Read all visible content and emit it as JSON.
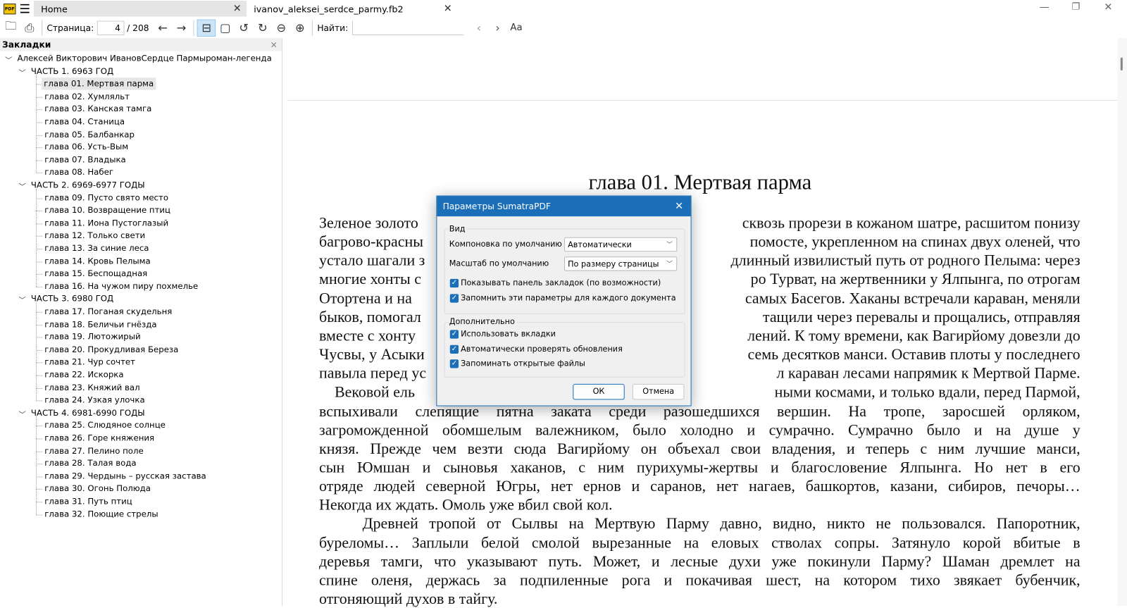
{
  "tabs": [
    {
      "label": "Home",
      "active": false
    },
    {
      "label": "ivanov_aleksei_serdce_parmy.fb2",
      "active": true
    }
  ],
  "toolbar": {
    "page_label": "Страница:",
    "page_current": "4",
    "page_total": "/ 208",
    "find_label": "Найти:",
    "find_value": ""
  },
  "sidebar": {
    "title": "Закладки",
    "root": "Алексей Викторович ИвановСердце Пармыроман-легенда",
    "parts": [
      {
        "label": "ЧАСТЬ 1. 6963 ГОД",
        "chapters": [
          "глава 01. Мертвая парма",
          "глава 02. Хумляльт",
          "глава 03. Канская тамга",
          "глава 04. Станица",
          "глава 05. Балбанкар",
          "глава 06. Усть-Вым",
          "глава 07. Владыка",
          "глава 08. Набег"
        ]
      },
      {
        "label": "ЧАСТЬ 2. 6969-6977 ГОДЫ",
        "chapters": [
          "глава 09. Пусто свято место",
          "глава 10. Возвращение птиц",
          "глава 11. Иона Пустоглазый",
          "глава 12. Только свети",
          "глава 13. За синие леса",
          "глава 14. Кровь Пелыма",
          "глава 15. Беспощадная",
          "глава 16. На чужом пиру похмелье"
        ]
      },
      {
        "label": "ЧАСТЬ 3. 6980 ГОД",
        "chapters": [
          "глава 17. Поганая скудельня",
          "глава 18. Беличьи гнёзда",
          "глава 19. Лютожирый",
          "глава 20. Прокудливая Береза",
          "глава 21. Чур сочтет",
          "глава 22. Искорка",
          "глава 23. Княжий вал",
          "глава 24. Узкая улочка"
        ]
      },
      {
        "label": "ЧАСТЬ 4. 6981-6990 ГОДЫ",
        "chapters": [
          "глава 25. Слюдяное солнце",
          "глава 26. Горе княжения",
          "глава 27. Пелино поле",
          "глава 28. Талая вода",
          "глава 29. Чердынь – русская застава",
          "глава 30. Огонь Полюда",
          "глава 31. Путь птиц",
          "глава 32. Поющие стрелы"
        ]
      }
    ],
    "selected": "глава 01. Мертвая парма"
  },
  "document": {
    "chapter_title": "глава 01. Мертвая парма",
    "partial_lines": [
      [
        "Зеленое золото",
        "сквозь прорези в кожаном шатре, расшитом понизу"
      ],
      [
        "багрово-красны",
        "помосте, укрепленном на спинах двух оленей, что"
      ],
      [
        "устало шагали з",
        "длинный извилистый путь от родного Пелыма: через"
      ],
      [
        "многие хонты с",
        "ро Турват, на жертвенники у Ялпынга, по отрогам"
      ],
      [
        "Отортена и на",
        "самых Басегов. Хаканы встречали караван, меняли"
      ],
      [
        "быков, помогал",
        "тащили через перевалы и прощались, отправляя"
      ],
      [
        "вместе с хонту",
        "лений. К тому времени, как Вагирйому довезли до"
      ],
      [
        "Чусвы, у Асыки",
        "семь десятков манси. Оставив плоты у последнего"
      ],
      [
        "павыла перед ус",
        "л караван лесами напрямик к Мертвой Парме."
      ],
      [
        "    Вековой ель",
        "ными космами, и только вдали, перед Пармой,"
      ]
    ],
    "full_lines": [
      "вспыхивали слепящие пятна заката среди разошедшихся вершин. На тропе, заросшей орляком,",
      "загроможденной обомшелым валежником, было холодно и сумрачно. Сумрачно было и на душе у",
      "князя. Прежде чем везти сюда Вагирйому он объехал свои владения, и теперь с ним лучшие манси,",
      "сын Юмшан и сыновья хаканов, с ним пурихумы-жертвы и благословение Ялпынга. Но нет в его",
      "отряде людей северной Югры, нет ернов и саранов, нет нагаев, башкортов, казани, сибиров, печоры…",
      "Некогда их ждать. Омоль уже вбил свой кол.",
      "    Древней тропой от Сылвы на Мертвую Парму давно, видно, никто не пользовался. Папоротник,",
      "буреломы… Заплыли белой смолой вырезанные на еловых стволах сопры. Затянуло корой вбитые в",
      "деревья тамги, что указывают путь. Может, и лесные духи уже покинули Парму? Шаман дремлет на",
      "спине оленя, держась за подпиленные рога и покачивая шест, на котором тихо звякает бубенчик,",
      "отгоняющий духов в тайгу."
    ]
  },
  "dialog": {
    "title": "Параметры SumatraPDF",
    "group_view": "Вид",
    "layout_label": "Компоновка по умолчанию",
    "layout_value": "Автоматически",
    "zoom_label": "Масштаб по умолчанию",
    "zoom_value": "По размеру страницы",
    "cb_bookmarks": "Показывать панель закладок (по возможности)",
    "cb_remember": "Запомнить эти параметры для каждого документа",
    "group_extra": "Дополнительно",
    "cb_tabs": "Использовать вкладки",
    "cb_updates": "Автоматически проверять обновления",
    "cb_files": "Запоминать открытые файлы",
    "ok": "ОК",
    "cancel": "Отмена"
  },
  "colors": {
    "accent": "#1a6fb8"
  }
}
